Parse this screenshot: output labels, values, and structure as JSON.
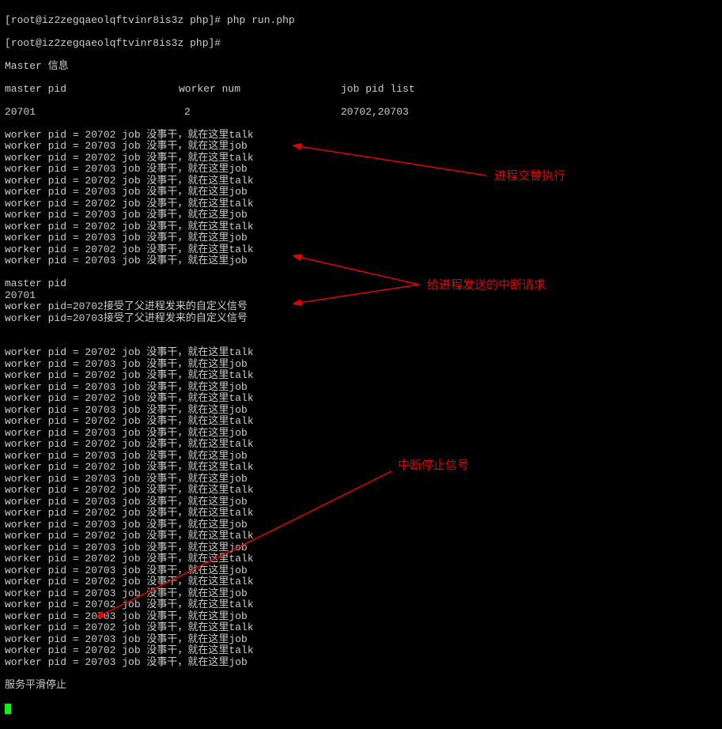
{
  "prompt_user": "root",
  "prompt_host": "iz2zegqaeolqftvinr8is3z",
  "prompt_path": "php",
  "prompt1_cmd": "php run.php",
  "prompt2_cmd": "",
  "section_header": "Master 信息",
  "table": {
    "headers": [
      "master pid",
      "worker num",
      "job pid list"
    ],
    "row": [
      "20701",
      "2",
      "20702,20703"
    ]
  },
  "block1": [
    "worker pid = 20702 job 没事干，就在这里talk",
    "worker pid = 20703 job 没事干，就在这里job",
    "worker pid = 20702 job 没事干，就在这里talk",
    "worker pid = 20703 job 没事干，就在这里job",
    "worker pid = 20702 job 没事干，就在这里talk",
    "worker pid = 20703 job 没事干，就在这里job",
    "worker pid = 20702 job 没事干，就在这里talk",
    "worker pid = 20703 job 没事干，就在这里job",
    "worker pid = 20702 job 没事干，就在这里talk",
    "worker pid = 20703 job 没事干，就在这里job",
    "worker pid = 20702 job 没事干，就在这里talk",
    "worker pid = 20703 job 没事干，就在这里job"
  ],
  "mid_lines": [
    "master pid",
    "20701",
    "worker pid=20702接受了父进程发来的自定义信号",
    "worker pid=20703接受了父进程发来的自定义信号",
    ""
  ],
  "block2": [
    "worker pid = 20702 job 没事干，就在这里talk",
    "worker pid = 20703 job 没事干，就在这里job",
    "worker pid = 20702 job 没事干，就在这里talk",
    "worker pid = 20703 job 没事干，就在这里job",
    "worker pid = 20702 job 没事干，就在这里talk",
    "worker pid = 20703 job 没事干，就在这里job",
    "worker pid = 20702 job 没事干，就在这里talk",
    "worker pid = 20703 job 没事干，就在这里job",
    "worker pid = 20702 job 没事干，就在这里talk",
    "worker pid = 20703 job 没事干，就在这里job",
    "worker pid = 20702 job 没事干，就在这里talk",
    "worker pid = 20703 job 没事干，就在这里job",
    "worker pid = 20702 job 没事干，就在这里talk",
    "worker pid = 20703 job 没事干，就在这里job",
    "worker pid = 20702 job 没事干，就在这里talk",
    "worker pid = 20703 job 没事干，就在这里job",
    "worker pid = 20702 job 没事干，就在这里talk",
    "worker pid = 20703 job 没事干，就在这里job",
    "worker pid = 20702 job 没事干，就在这里talk",
    "worker pid = 20703 job 没事干，就在这里job",
    "worker pid = 20702 job 没事干，就在这里talk",
    "worker pid = 20703 job 没事干，就在这里job",
    "worker pid = 20702 job 没事干，就在这里talk",
    "worker pid = 20703 job 没事干，就在这里job",
    "worker pid = 20702 job 没事干，就在这里talk",
    "worker pid = 20703 job 没事干，就在这里job",
    "worker pid = 20702 job 没事干，就在这里talk",
    "worker pid = 20703 job 没事干，就在这里job"
  ],
  "final_line": "服务平滑停止",
  "annotations": {
    "a1": "进程交替执行",
    "a2": "给进程发送的中断请求",
    "a3": "中断停止信号"
  }
}
